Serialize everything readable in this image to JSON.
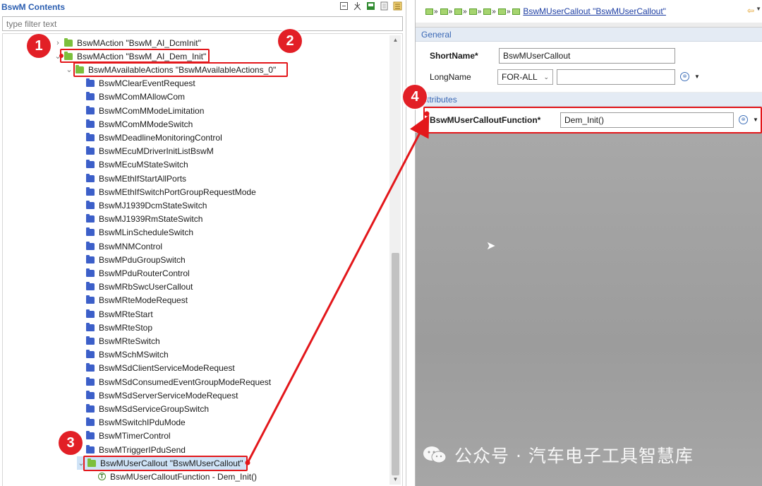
{
  "left_panel": {
    "title": "BswM Contents",
    "filter_placeholder": "type filter text",
    "tree": [
      {
        "label": "BswMAction \"BswM_AI_DcmInit\"",
        "twisty": "›",
        "icon": "folder-green"
      },
      {
        "label": "BswMAction \"BswM_AI_Dem_Init\"",
        "twisty": "⌄",
        "icon": "folder-green"
      },
      {
        "label": "BswMAvailableActions \"BswMAvailableActions_0\"",
        "twisty": "⌄",
        "icon": "folder-green"
      },
      {
        "label": "BswMClearEventRequest",
        "icon": "folder-blue"
      },
      {
        "label": "BswMComMAllowCom",
        "icon": "folder-blue"
      },
      {
        "label": "BswMComMModeLimitation",
        "icon": "folder-blue"
      },
      {
        "label": "BswMComMModeSwitch",
        "icon": "folder-blue"
      },
      {
        "label": "BswMDeadlineMonitoringControl",
        "icon": "folder-blue"
      },
      {
        "label": "BswMEcuMDriverInitListBswM",
        "icon": "folder-blue"
      },
      {
        "label": "BswMEcuMStateSwitch",
        "icon": "folder-blue"
      },
      {
        "label": "BswMEthIfStartAllPorts",
        "icon": "folder-blue"
      },
      {
        "label": "BswMEthIfSwitchPortGroupRequestMode",
        "icon": "folder-blue"
      },
      {
        "label": "BswMJ1939DcmStateSwitch",
        "icon": "folder-blue"
      },
      {
        "label": "BswMJ1939RmStateSwitch",
        "icon": "folder-blue"
      },
      {
        "label": "BswMLinScheduleSwitch",
        "icon": "folder-blue"
      },
      {
        "label": "BswMNMControl",
        "icon": "folder-blue"
      },
      {
        "label": "BswMPduGroupSwitch",
        "icon": "folder-blue"
      },
      {
        "label": "BswMPduRouterControl",
        "icon": "folder-blue"
      },
      {
        "label": "BswMRbSwcUserCallout",
        "icon": "folder-blue"
      },
      {
        "label": "BswMRteModeRequest",
        "icon": "folder-blue"
      },
      {
        "label": "BswMRteStart",
        "icon": "folder-blue"
      },
      {
        "label": "BswMRteStop",
        "icon": "folder-blue"
      },
      {
        "label": "BswMRteSwitch",
        "icon": "folder-blue"
      },
      {
        "label": "BswMSchMSwitch",
        "icon": "folder-blue"
      },
      {
        "label": "BswMSdClientServiceModeRequest",
        "icon": "folder-blue"
      },
      {
        "label": "BswMSdConsumedEventGroupModeRequest",
        "icon": "folder-blue"
      },
      {
        "label": "BswMSdServerServiceModeRequest",
        "icon": "folder-blue"
      },
      {
        "label": "BswMSdServiceGroupSwitch",
        "icon": "folder-blue"
      },
      {
        "label": "BswMSwitchIPduMode",
        "icon": "folder-blue"
      },
      {
        "label": "BswMTimerControl",
        "icon": "folder-blue"
      },
      {
        "label": "BswMTriggerIPduSend",
        "icon": "folder-blue"
      },
      {
        "label": "BswMUserCallout \"BswMUserCallout\"",
        "twisty": "⌄",
        "icon": "folder-green"
      },
      {
        "label": "BswMUserCalloutFunction - Dem_Init()",
        "icon": "param-icon"
      }
    ]
  },
  "right_panel": {
    "breadcrumb_link": "BswMUserCallout \"BswMUserCallout\"",
    "general": {
      "section_label": "General",
      "short_name_label": "ShortName*",
      "short_name_value": "BswMUserCallout",
      "long_name_label": "LongName",
      "long_name_lang": "FOR-ALL",
      "long_name_value": ""
    },
    "attributes": {
      "section_label": "Attributes",
      "function_label": "BswMUserCalloutFunction*",
      "function_value": "Dem_Init()"
    }
  },
  "annotations": {
    "badges": [
      "1",
      "2",
      "3",
      "4"
    ],
    "accent_color": "#e3171b"
  },
  "watermark": {
    "text": "公众号 · 汽车电子工具智慧库"
  },
  "icons": [
    "collapse-all-icon",
    "link-icon",
    "new-element-icon",
    "document-icon",
    "tree-view-icon",
    "back-arrow-icon",
    "reset-default-icon"
  ]
}
